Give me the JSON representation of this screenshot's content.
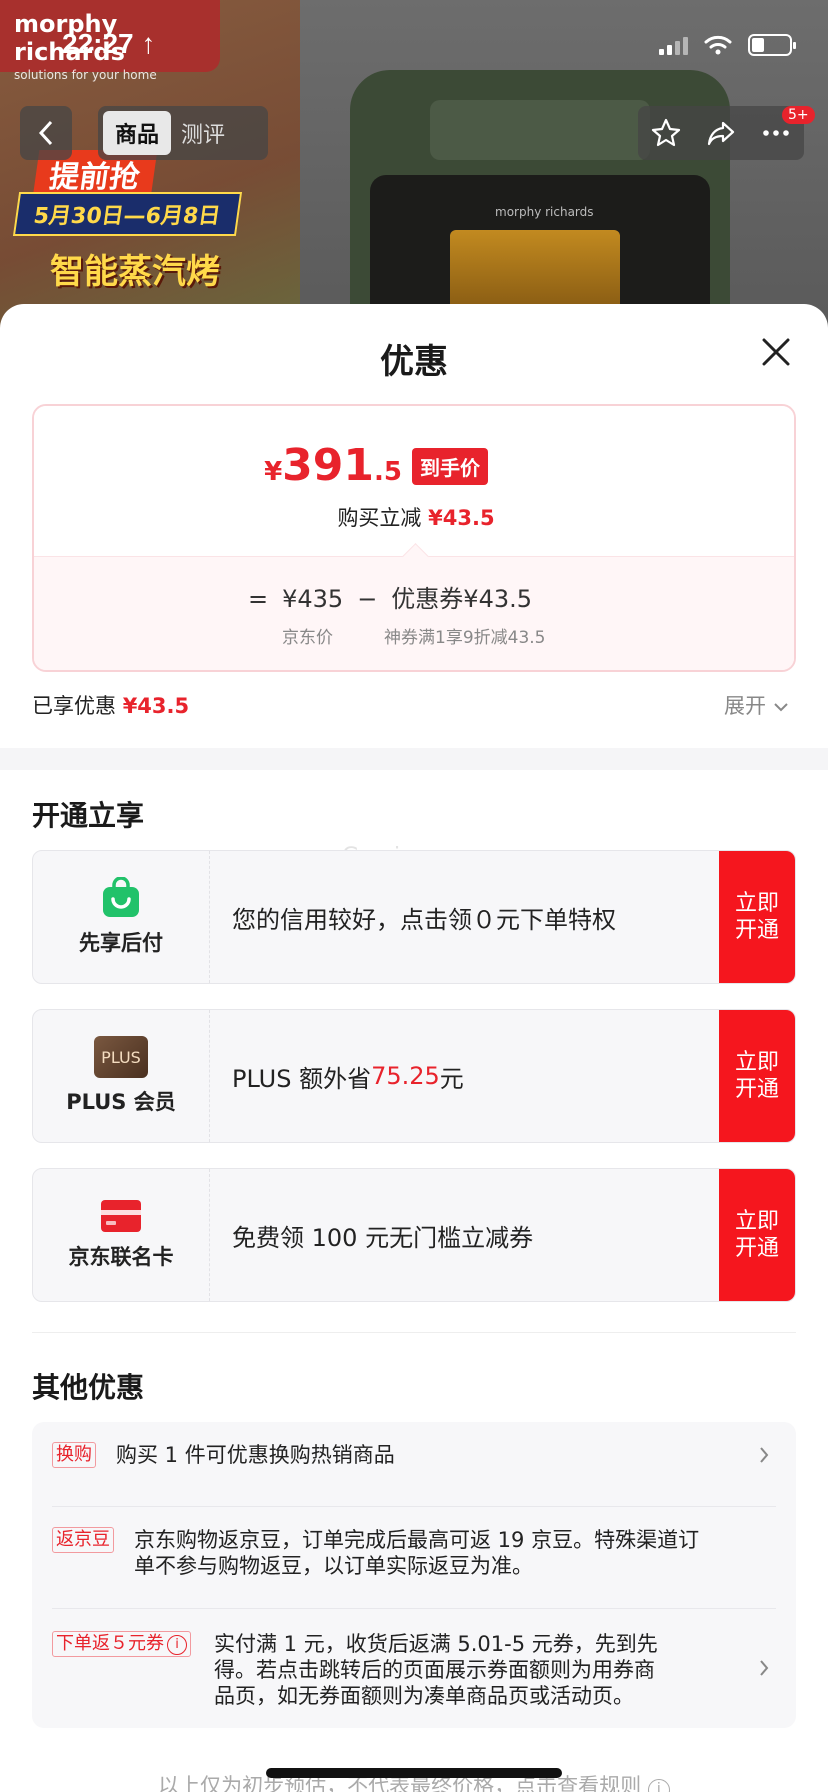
{
  "status_bar": {
    "time": "22:27 ↑"
  },
  "background": {
    "brand": "morphy richards",
    "brand_sub": "solutions for your home",
    "promo_line1": "提前抢",
    "promo_line2": "5月30日—6月8日",
    "promo_line3": "智能蒸汽烤",
    "oven_logo": "morphy richards"
  },
  "top_nav": {
    "back_icon": "chevron-left-icon",
    "tabs": [
      {
        "label": "商品",
        "active": true
      },
      {
        "label": "测评",
        "active": false
      }
    ],
    "right_icons": [
      "star-icon",
      "share-icon",
      "more-icon"
    ],
    "badge": "5+"
  },
  "sheet": {
    "title": "优惠",
    "price_card": {
      "currency": "¥",
      "price_int": "391",
      "price_dec": ".5",
      "tag": "到手价",
      "reduce_label": "购买立减",
      "reduce_value": "¥43.5",
      "formula_eq": "=",
      "jd_price": "¥435",
      "minus": "−",
      "coupon": "优惠券¥43.5",
      "jd_price_label": "京东价",
      "coupon_label": "神券满1享9折减43.5"
    },
    "enjoyed_label": "已享优惠",
    "enjoyed_value": "¥43.5",
    "expand_label": "展开",
    "watermark": "Gemine",
    "open_section": {
      "title": "开通立享",
      "cards": [
        {
          "label": "先享后付",
          "icon": "shopping-bag-icon",
          "text": "您的信用较好，点击领０元下单特权",
          "text_red": "",
          "text_after": "",
          "button": [
            "立即",
            "开通"
          ]
        },
        {
          "label": "PLUS 会员",
          "icon": "plus-badge-icon",
          "icon_text": "PLUS",
          "text": "PLUS 额外省 ",
          "text_red": "75.25",
          "text_after": " 元",
          "button": [
            "立即",
            "开通"
          ]
        },
        {
          "label": "京东联名卡",
          "icon": "credit-card-icon",
          "text": "免费领 100 元无门槛立减券",
          "text_red": "",
          "text_after": "",
          "button": [
            "立即",
            "开通"
          ]
        }
      ]
    },
    "other_section": {
      "title": "其他优惠",
      "items": [
        {
          "tag": "换购",
          "lines": [
            "购买 1 件可优惠换购热销商品"
          ],
          "chevron": true
        },
        {
          "tag": "返京豆",
          "lines": [
            "京东购物返京豆，订单完成后最高可返 19 京豆。特殊渠道订",
            "单不参与购物返豆，以订单实际返豆为准。"
          ],
          "chevron": false
        },
        {
          "tag": "下单返５元券",
          "lines": [
            "实付满 1 元，收货后返满 5.01-5 元券，先到先",
            "得。若点击跳转后的页面展示券面额则为用券商",
            "品页，如无券面额则为凑单商品页或活动页。"
          ],
          "chevron": true
        }
      ]
    },
    "footnote": "以上仅为初步预估，不代表最终价格，点击查看规则"
  }
}
